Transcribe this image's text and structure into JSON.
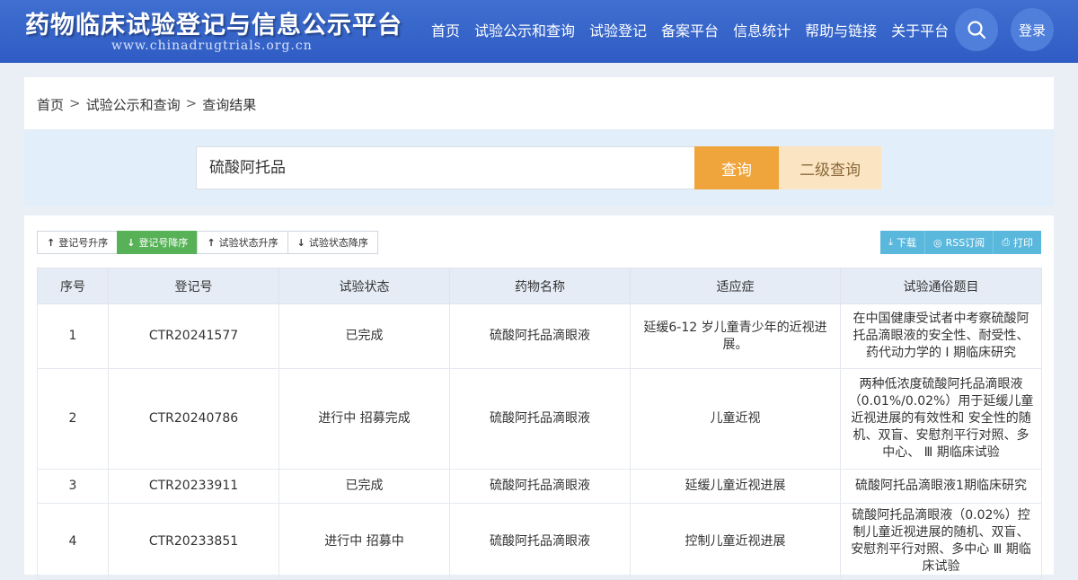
{
  "header": {
    "title": "药物临床试验登记与信息公示平台",
    "url": "www.chinadrugtrials.org.cn",
    "nav": [
      "首页",
      "试验公示和查询",
      "试验登记",
      "备案平台",
      "信息统计",
      "帮助与链接",
      "关于平台"
    ],
    "search_icon": "search-icon",
    "login_label": "登录"
  },
  "breadcrumb": {
    "items": [
      "首页",
      "试验公示和查询",
      "查询结果"
    ],
    "separator": ">"
  },
  "search": {
    "value": "硫酸阿托品",
    "query_label": "查询",
    "advanced_label": "二级查询"
  },
  "sort_buttons": [
    {
      "arrow": "↑",
      "label": "登记号升序",
      "active": false
    },
    {
      "arrow": "↓",
      "label": "登记号降序",
      "active": true
    },
    {
      "arrow": "↑",
      "label": "试验状态升序",
      "active": false
    },
    {
      "arrow": "↓",
      "label": "试验状态降序",
      "active": false
    }
  ],
  "tools": [
    {
      "icon": "download-icon",
      "glyph": "⤓",
      "label": "下载"
    },
    {
      "icon": "rss-icon",
      "glyph": "◎",
      "label": "RSS订阅"
    },
    {
      "icon": "print-icon",
      "glyph": "⎙",
      "label": "打印"
    }
  ],
  "table": {
    "headers": [
      "序号",
      "登记号",
      "试验状态",
      "药物名称",
      "适应症",
      "试验通俗题目"
    ],
    "rows": [
      [
        "1",
        "CTR20241577",
        "已完成",
        "硫酸阿托品滴眼液",
        "延缓6-12 岁儿童青少年的近视进展。",
        "在中国健康受试者中考察硫酸阿托品滴眼液的安全性、耐受性、药代动力学的 I 期临床研究"
      ],
      [
        "2",
        "CTR20240786",
        "进行中 招募完成",
        "硫酸阿托品滴眼液",
        "儿童近视",
        "两种低浓度硫酸阿托品滴眼液（0.01%/0.02%）用于延缓儿童近视进展的有效性和 安全性的随机、双盲、安慰剂平行对照、多中心、 Ⅲ 期临床试验"
      ],
      [
        "3",
        "CTR20233911",
        "已完成",
        "硫酸阿托品滴眼液",
        "延缓儿童近视进展",
        "硫酸阿托品滴眼液1期临床研究"
      ],
      [
        "4",
        "CTR20233851",
        "进行中 招募中",
        "硫酸阿托品滴眼液",
        "控制儿童近视进展",
        "硫酸阿托品滴眼液（0.02%）控制儿童近视进展的随机、双盲、安慰剂平行对照、多中心 Ⅲ 期临床试验"
      ]
    ]
  },
  "colors": {
    "header_blue": "#3565c8",
    "query_orange": "#f0a53c",
    "advanced_light": "#fbe4c1",
    "active_green": "#57b157",
    "tool_blue": "#5bb8dd"
  }
}
